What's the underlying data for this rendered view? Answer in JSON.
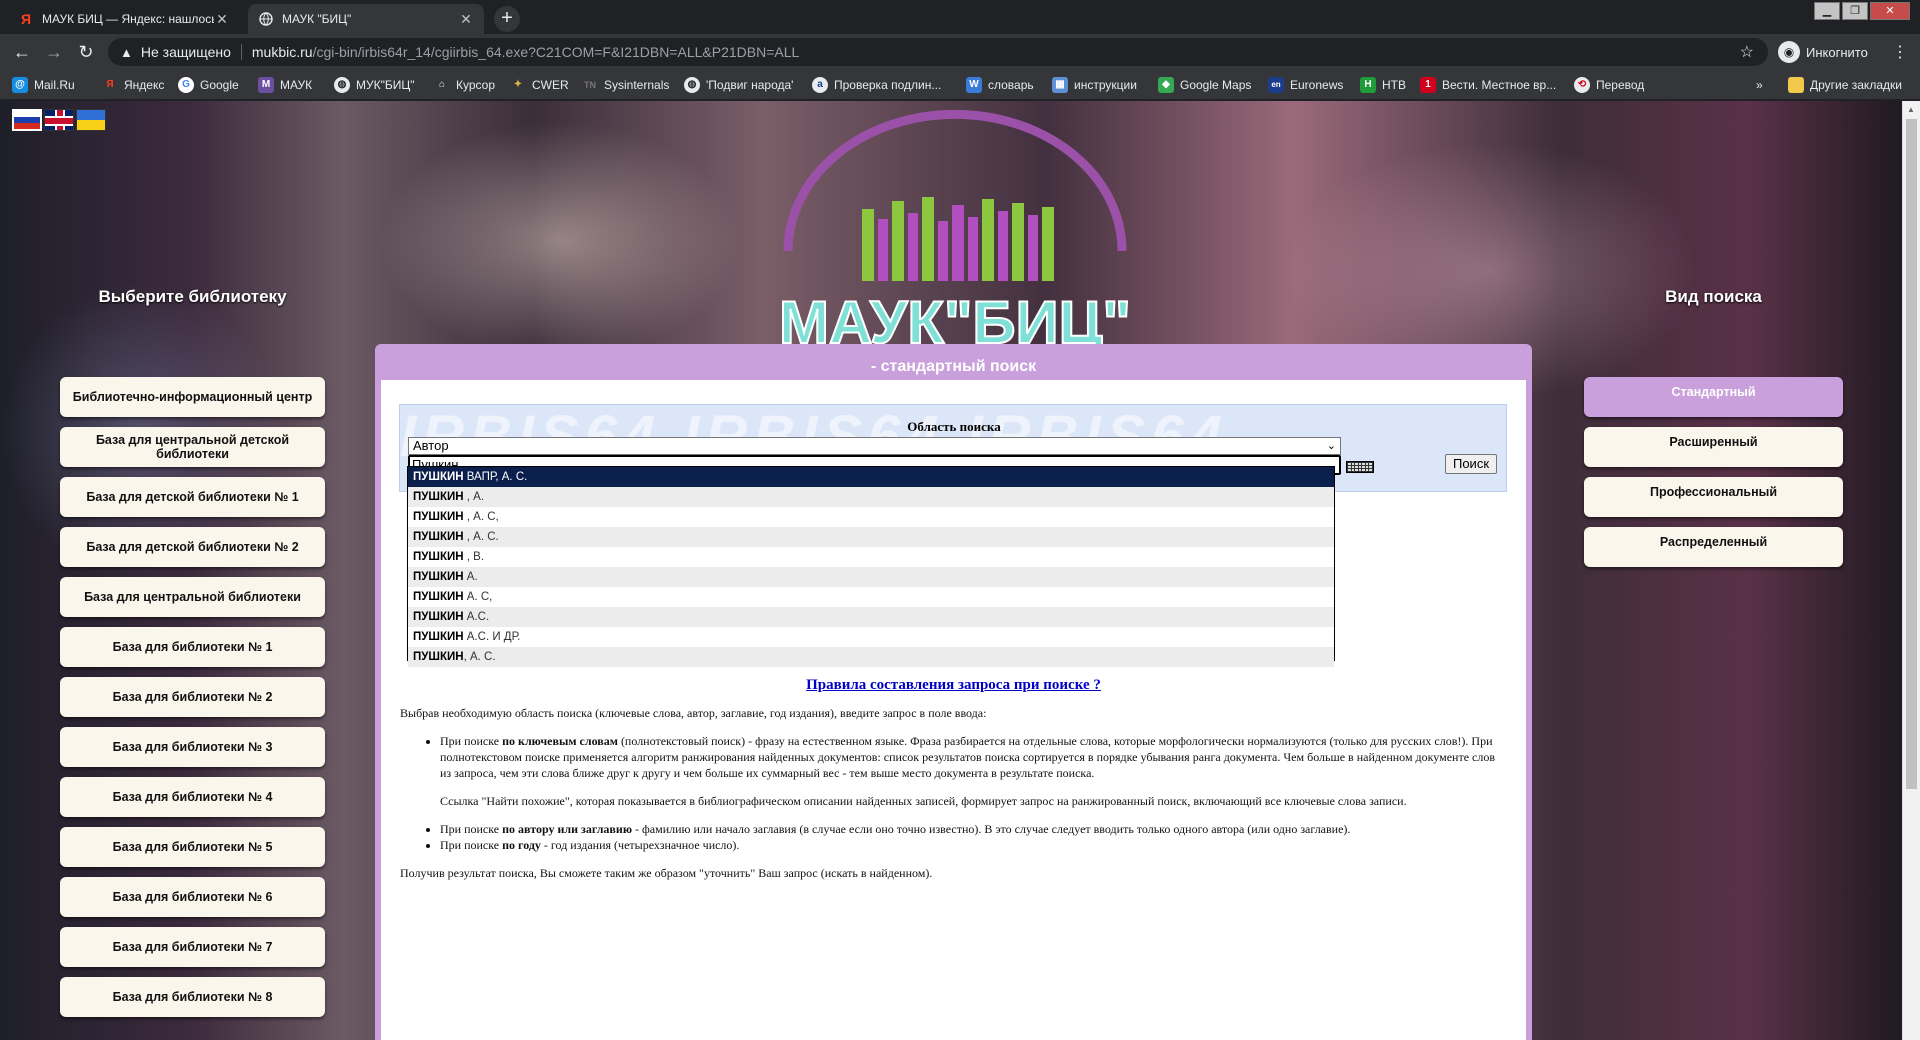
{
  "browser": {
    "tabs": [
      {
        "title": "МАУК БИЦ — Яндекс: нашлось",
        "favicon": "yandex-icon",
        "active": false
      },
      {
        "title": "МАУК \"БИЦ\"",
        "favicon": "globe-icon",
        "active": true
      }
    ],
    "address": {
      "security_label": "Не защищено",
      "host": "mukbic.ru",
      "path": "/cgi-bin/irbis64r_14/cgiirbis_64.exe?C21COM=F&I21DBN=ALL&P21DBN=ALL"
    },
    "incognito_label": "Инкогнито",
    "bookmarks": [
      {
        "label": "Mail.Ru",
        "icon": "mailru-icon"
      },
      {
        "label": "Яндекс",
        "icon": "yandex-icon"
      },
      {
        "label": "Google",
        "icon": "google-icon"
      },
      {
        "label": "МАУК",
        "icon": "mauk-icon"
      },
      {
        "label": "МУК\"БИЦ\"",
        "icon": "globe-icon"
      },
      {
        "label": "Курсор",
        "icon": "kursor-icon"
      },
      {
        "label": "CWER",
        "icon": "cwer-icon"
      },
      {
        "label": "Sysinternals",
        "icon": "sysinternals-icon"
      },
      {
        "label": "'Подвиг народа'",
        "icon": "podvig-icon"
      },
      {
        "label": "Проверка подлин...",
        "icon": "check-icon"
      },
      {
        "label": "словарь",
        "icon": "dictionary-icon"
      },
      {
        "label": "инструкции",
        "icon": "instructions-icon"
      },
      {
        "label": "Google Maps",
        "icon": "maps-icon"
      },
      {
        "label": "Euronews",
        "icon": "euronews-icon"
      },
      {
        "label": "НТВ",
        "icon": "ntv-icon"
      },
      {
        "label": "Вести. Местное вр...",
        "icon": "vesti-icon"
      },
      {
        "label": "Перевод",
        "icon": "translate-icon"
      }
    ],
    "other_bookmarks": "Другие закладки",
    "bookmarks_overflow": "»"
  },
  "site": {
    "logo_text": "МАУК\"БИЦ\"",
    "left_title": "Выберите библиотеку",
    "libraries": [
      "Библиотечно-информационный центр",
      "База для центральной детской библиотеки",
      "База для детской библиотеки № 1",
      "База для детской библиотеки № 2",
      "База для центральной библиотеки",
      "База для библиотеки № 1",
      "База для библиотеки № 2",
      "База для библиотеки № 3",
      "База для библиотеки № 4",
      "База для библиотеки № 5",
      "База для библиотеки № 6",
      "База для библиотеки № 7",
      "База для библиотеки № 8"
    ],
    "right_title": "Вид поиска",
    "search_views": [
      "Стандартный",
      "Расширенный",
      "Профессиональный",
      "Распределенный"
    ],
    "selected_view": "Стандартный",
    "main_title": "- стандартный поиск",
    "search": {
      "area_label": "Область поиска",
      "area_value": "Автор",
      "query_value": "Пушкин",
      "button_label": "Поиск",
      "background_text": "IRBIS64 IRBIS64 IRBIS64"
    },
    "suggestions": [
      {
        "bold": "ПУШКИН",
        "rest": " ВАПР, А. С."
      },
      {
        "bold": "ПУШКИН",
        "rest": " , А."
      },
      {
        "bold": "ПУШКИН",
        "rest": " , А. С,"
      },
      {
        "bold": "ПУШКИН",
        "rest": " , А. С."
      },
      {
        "bold": "ПУШКИН",
        "rest": " , В."
      },
      {
        "bold": "ПУШКИН",
        "rest": " А."
      },
      {
        "bold": "ПУШКИН",
        "rest": " А. С,"
      },
      {
        "bold": "ПУШКИН",
        "rest": " А.С."
      },
      {
        "bold": "ПУШКИН",
        "rest": " А.С. И ДР."
      },
      {
        "bold": "ПУШКИН",
        "rest": ", А. С."
      }
    ],
    "rules_link": "Правила составления запроса при поиске ?",
    "help": {
      "intro": "Выбрав необходимую область поиска (ключевые слова, автор, заглавие, год издания), введите запрос в поле ввода:",
      "kw_prefix": "При поиске ",
      "kw_bold": "по ключевым словам",
      "kw_text": " (полнотекстовый поиск) - фразу на естественном языке. Фраза разбирается на отдельные слова, которые морфологически нормализуются (только для русских слов!). При полнотекстовом поиске применяется алгоритм ранжирования найденных документов: список результатов поиска сортируется в порядке убывания ранга документа. Чем больше в найденном документе слов из запроса, чем эти слова ближе друг к другу и чем больше их суммарный вес - тем выше место документа в результате поиска.",
      "similar": "Ссылка \"Найти похожие\", которая показывается в библиографическом описании найденных записей, формирует запрос на ранжированный поиск, включающий все ключевые слова записи.",
      "author_prefix": "При поиске ",
      "author_bold": "по автору или заглавию",
      "author_text": " - фамилию или начало заглавия (в случае если оно точно известно). В это случае следует вводить только одного автора (или одно заглавие).",
      "year_prefix": "При поиске ",
      "year_bold": "по году",
      "year_text": " - год издания (четырехзначное число).",
      "outro": "Получив результат поиска, Вы сможете таким же образом \"уточнить\" Ваш запрос (искать в найденном)."
    }
  },
  "colors": {
    "accent": "#c9a0dc",
    "highlight": "#0b1f4d",
    "link": "#0000c8"
  }
}
